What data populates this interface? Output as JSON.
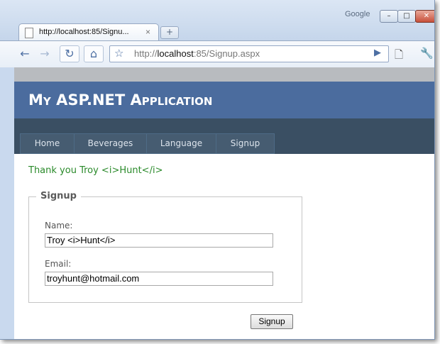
{
  "window": {
    "brand_label": "Google",
    "min_glyph": "–",
    "max_glyph": "□",
    "close_glyph": "✕"
  },
  "tab": {
    "title": "http://localhost:85/Signu...",
    "close_glyph": "×",
    "new_tab_glyph": "+"
  },
  "toolbar": {
    "back_glyph": "←",
    "forward_glyph": "→",
    "reload_glyph": "↻",
    "home_glyph": "⌂",
    "star_glyph": "☆",
    "url_prefix": "http://",
    "url_host": "localhost",
    "url_rest": ":85/Signup.aspx",
    "go_glyph": "▶",
    "page_glyph": "🗋",
    "wrench_glyph": "🔧"
  },
  "site": {
    "title": "My ASP.NET Application",
    "menu": [
      "Home",
      "Beverages",
      "Language",
      "Signup"
    ]
  },
  "main": {
    "thanks_message": "Thank you Troy <i>Hunt</i>",
    "legend": "Signup",
    "name_label": "Name:",
    "name_value": "Troy <i>Hunt</i>",
    "email_label": "Email:",
    "email_value": "troyhunt@hotmail.com",
    "submit_label": "Signup"
  },
  "colors": {
    "header": "#4b6c9e",
    "menubar": "#3a4f63",
    "thanks_text": "#2a8a2a"
  }
}
